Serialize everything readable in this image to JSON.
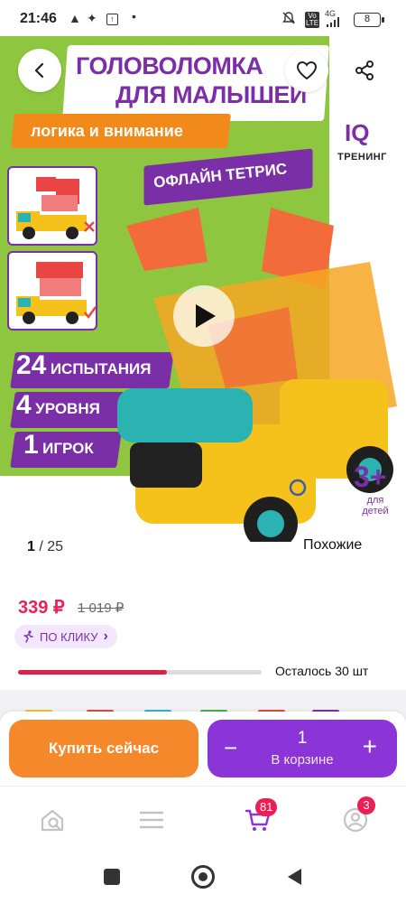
{
  "status_bar": {
    "time": "21:46",
    "network": "4G",
    "lte": "Vo LTE",
    "battery": "8"
  },
  "gallery": {
    "image_text": {
      "title_line1": "ГОЛОВОЛОМКА",
      "title_line2": "ДЛЯ МАЛЫШЕЙ",
      "subtitle": "логика и внимание",
      "tag": "ОФЛАЙН ТЕТРИС",
      "brand_iq": "IQ",
      "brand_sub": "ТРЕНИНГ",
      "stat1_num": "24",
      "stat1_text": "ИСПЫТАНИЯ",
      "stat2_num": "4",
      "stat2_text": "УРОВНЯ",
      "stat3_num": "1",
      "stat3_text": "ИГРОК",
      "age": "3+",
      "age_sub": "для детей"
    },
    "counter_current": "1",
    "counter_sep": " / ",
    "counter_total": "25",
    "similar_label": "Похожие"
  },
  "price": {
    "current": "339 ₽",
    "old": "1 019 ₽",
    "promo_label": "ПО КЛИКУ",
    "promo_chevron": "›"
  },
  "stock": {
    "text": "Осталось 30 шт",
    "fill_fraction": 0.61
  },
  "actions": {
    "buy_now": "Купить сейчас",
    "minus": "−",
    "plus": "+",
    "quantity": "1",
    "in_cart": "В корзине"
  },
  "nav": {
    "cart_badge": "81",
    "profile_badge": "3"
  },
  "colors": {
    "accent_purple": "#8b34d8",
    "buy_orange": "#f5882a",
    "price_red": "#ec1f55",
    "image_green": "#8ec63f"
  },
  "icons": [
    "back-arrow-icon",
    "heart-icon",
    "share-icon",
    "play-icon",
    "home-search-icon",
    "menu-icon",
    "cart-icon",
    "profile-icon"
  ]
}
